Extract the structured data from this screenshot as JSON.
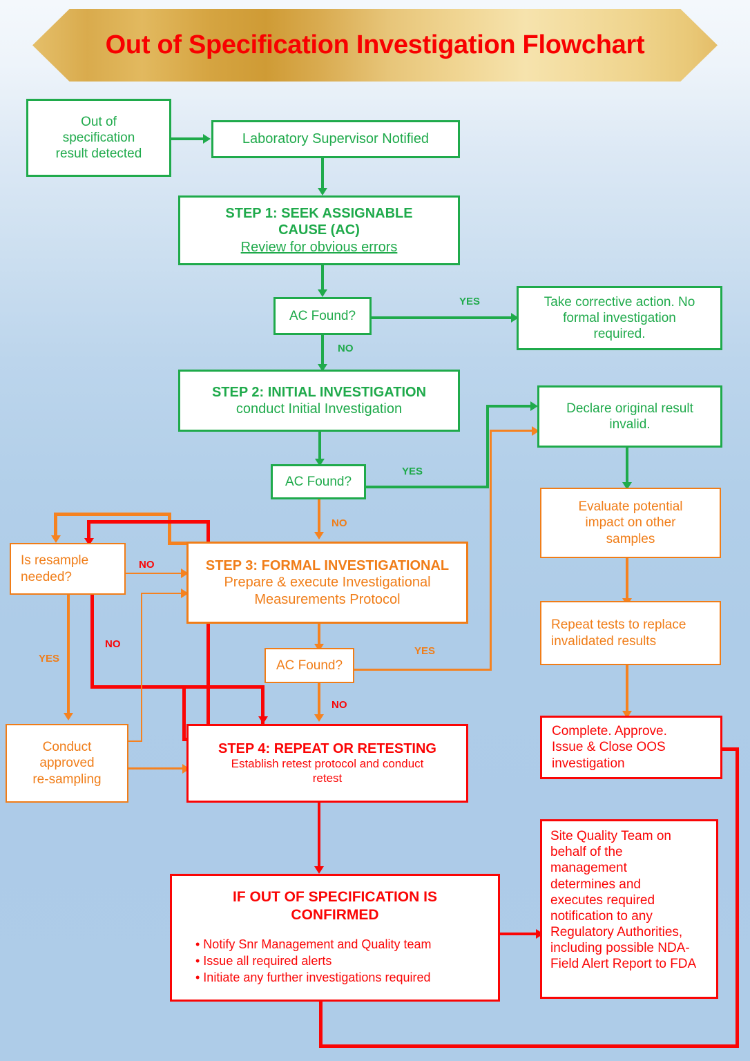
{
  "banner": {
    "title": "Out of Specification Investigation Flowchart"
  },
  "colors": {
    "green": "#1faa4b",
    "orange": "#f07d18",
    "red": "#fa0505",
    "banner_gold": "#e2b95f",
    "background_blue": "#adcbe8"
  },
  "nodes": {
    "start": {
      "line1": "Out of",
      "line2": "specification",
      "line3": "result detected"
    },
    "lab_supervisor": {
      "label": "Laboratory Supervisor Notified"
    },
    "step1": {
      "title_line1": "STEP 1: SEEK  ASSIGNABLE",
      "title_line2": "CAUSE (AC)",
      "subtitle": "Review for obvious errors"
    },
    "ac_found_1": {
      "label": "AC Found?"
    },
    "corrective_action": {
      "line1": "Take corrective action. No",
      "line2": "formal investigation",
      "line3": "required."
    },
    "step2": {
      "title": "STEP 2: INITIAL INVESTIGATION",
      "subtitle": "conduct Initial Investigation"
    },
    "ac_found_2": {
      "label": "AC Found?"
    },
    "declare_invalid": {
      "line1": "Declare original result",
      "line2": "invalid."
    },
    "evaluate_impact": {
      "line1": "Evaluate potential",
      "line2": "impact on other",
      "line3": "samples"
    },
    "repeat_tests": {
      "line1": "Repeat tests to replace",
      "line2": "invalidated results"
    },
    "complete_approve": {
      "line1": "Complete. Approve.",
      "line2": "Issue & Close OOS",
      "line3": "investigation"
    },
    "is_resample": {
      "line1": "Is resample",
      "line2": "needed?"
    },
    "step3": {
      "title": "STEP 3: FORMAL INVESTIGATIONAL",
      "subtitle_line1": "Prepare & execute Investigational",
      "subtitle_line2": "Measurements Protocol"
    },
    "ac_found_3": {
      "label": "AC Found?"
    },
    "conduct_resampling": {
      "line1": "Conduct",
      "line2": "approved",
      "line3": "re-sampling"
    },
    "step4": {
      "title": "STEP 4: REPEAT  OR  RETESTING",
      "subtitle_line1": "Establish retest protocol  and  conduct",
      "subtitle_line2": "retest"
    },
    "oos_confirmed": {
      "title_line1": "IF OUT OF SPECIFICATION  IS",
      "title_line2": "CONFIRMED",
      "bullets": [
        "• Notify Snr Management  and Quality team",
        "• Issue all required alerts",
        "• Initiate any further  investigations required"
      ]
    },
    "site_quality_team": {
      "lines": [
        "Site Quality Team  on",
        "behalf of the",
        "management",
        "determines and",
        "executes required",
        "notification to any",
        "Regulatory Authorities,",
        "including possible NDA-",
        "Field Alert Report to FDA"
      ]
    }
  },
  "edge_labels": {
    "yes_1": "YES",
    "no_1": "NO",
    "yes_2": "YES",
    "no_2": "NO",
    "no_resample_top": "NO",
    "no_resample_bottom": "NO",
    "yes_resample": "YES",
    "yes_3": "YES",
    "no_3": "NO"
  }
}
